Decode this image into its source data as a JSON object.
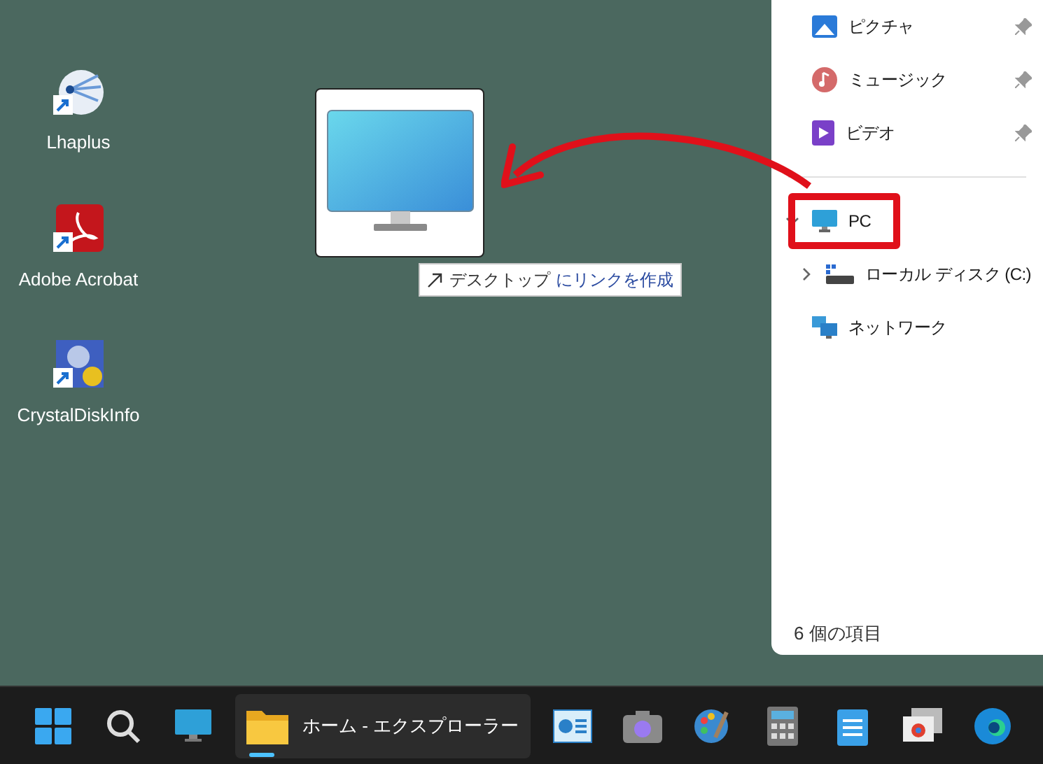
{
  "desktop": {
    "icons": [
      {
        "label": "Lhaplus",
        "kind": "lhaplus"
      },
      {
        "label": "Adobe Acrobat",
        "kind": "acrobat"
      },
      {
        "label": "CrystalDiskInfo",
        "kind": "crystal"
      }
    ],
    "drag_tooltip": {
      "target": "デスクトップ",
      "action": "にリンクを作成"
    }
  },
  "explorer": {
    "nav": [
      {
        "label": "ピクチャ",
        "kind": "pictures",
        "pinned": true
      },
      {
        "label": "ミュージック",
        "kind": "music",
        "pinned": true
      },
      {
        "label": "ビデオ",
        "kind": "video",
        "pinned": true
      },
      {
        "label": "PC",
        "kind": "pc",
        "expanded": true,
        "highlighted": true,
        "children": [
          {
            "label": "ローカル ディスク (C:)",
            "kind": "disk",
            "expanded": false
          }
        ]
      },
      {
        "label": "ネットワーク",
        "kind": "network",
        "highlighted": false
      }
    ],
    "status_bar": "6 個の項目"
  },
  "taskbar": {
    "items": [
      {
        "kind": "start"
      },
      {
        "kind": "search"
      },
      {
        "kind": "desktop"
      },
      {
        "kind": "explorer",
        "label": "ホーム - エクスプローラー",
        "active": true
      },
      {
        "kind": "chart"
      },
      {
        "kind": "camera"
      },
      {
        "kind": "paint"
      },
      {
        "kind": "calculator"
      },
      {
        "kind": "notepad"
      },
      {
        "kind": "windows"
      },
      {
        "kind": "edge"
      }
    ]
  }
}
